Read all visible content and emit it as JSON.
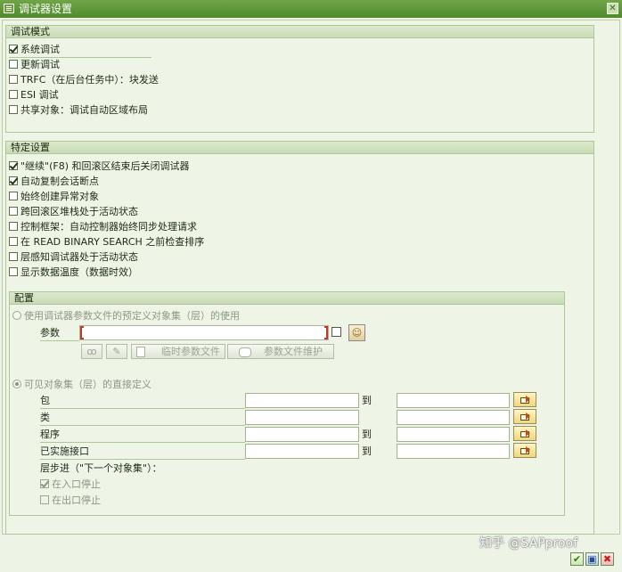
{
  "window": {
    "title": "调试器设置",
    "close_glyph": "✕"
  },
  "debug_mode": {
    "title": "调试模式",
    "options": [
      {
        "label": "系统调试",
        "checked": true
      },
      {
        "label": "更新调试",
        "checked": false
      },
      {
        "label": "TRFC（在后台任务中）：块发送",
        "checked": false
      },
      {
        "label": "ESI 调试",
        "checked": false
      },
      {
        "label": "共享对象：调试自动区域布局",
        "checked": false
      }
    ]
  },
  "special_settings": {
    "title": "特定设置",
    "options": [
      {
        "label": "\"继续\"(F8) 和回滚区结束后关闭调试器",
        "checked": true
      },
      {
        "label": "自动复制会话断点",
        "checked": true
      },
      {
        "label": "始终创建异常对象",
        "checked": false
      },
      {
        "label": "跨回滚区堆栈处于活动状态",
        "checked": false
      },
      {
        "label": "控制框架：自动控制器始终同步处理请求",
        "checked": false
      },
      {
        "label": "在 READ BINARY SEARCH 之前检查排序",
        "checked": false
      },
      {
        "label": "层感知调试器处于活动状态",
        "checked": false
      },
      {
        "label": "显示数据温度（数据时效）",
        "checked": false
      }
    ]
  },
  "config": {
    "title": "配置",
    "radio_predefined": "使用调试器参数文件的预定义对象集（层）的使用",
    "param_label": "参数",
    "param_value": "",
    "btn_temp_file": "临时参数文件",
    "btn_maintain_file": "参数文件维护",
    "radio_direct": "可见对象集（层）的直接定义",
    "to_label": "到",
    "rows": [
      {
        "label": "包",
        "from": "",
        "to": ""
      },
      {
        "label": "类",
        "from": "",
        "to": ""
      },
      {
        "label": "程序",
        "from": "",
        "to": ""
      },
      {
        "label": "已实施接口",
        "from": "",
        "to": ""
      }
    ],
    "step_label": "层步进（\"下一个对象集\"）：",
    "stop_entry": {
      "label": "在入口停止",
      "checked": true
    },
    "stop_exit": {
      "label": "在出口停止",
      "checked": false
    }
  },
  "footer": {
    "watermark": "知乎 @SAPproof",
    "icons": [
      "check-icon",
      "save-icon",
      "cancel-icon"
    ]
  }
}
